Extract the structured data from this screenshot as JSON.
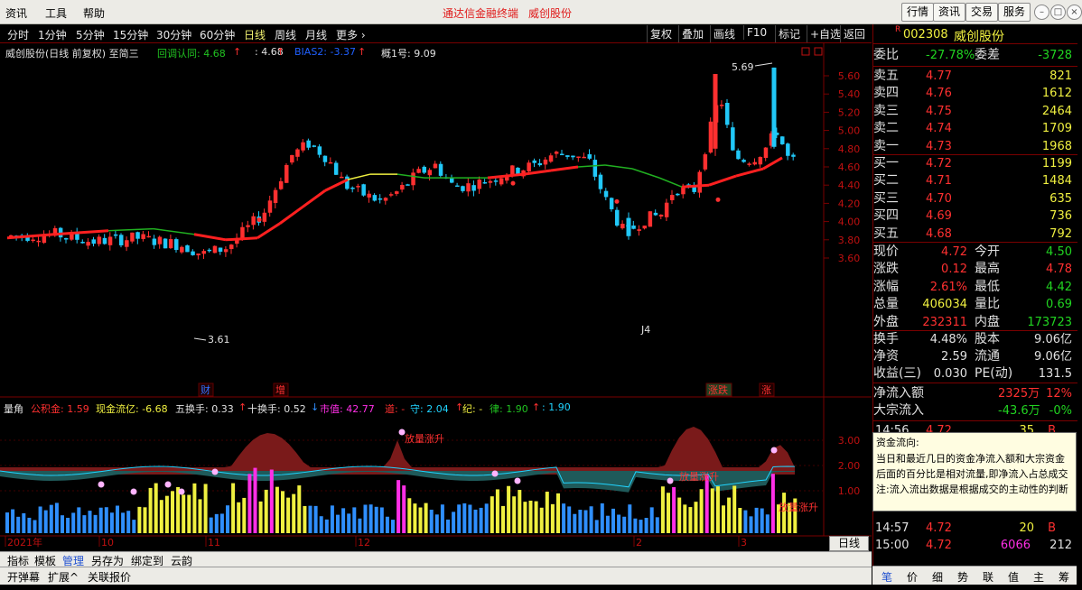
{
  "menubar": {
    "items": [
      "资讯",
      "工具",
      "帮助"
    ],
    "center_title": "通达信金融终端",
    "stock_title": "威创股份",
    "right_buttons": [
      "行情",
      "资讯",
      "交易",
      "服务"
    ]
  },
  "toolbar": {
    "periods": [
      "分时",
      "1分钟",
      "5分钟",
      "15分钟",
      "30分钟",
      "60分钟",
      "日线",
      "周线",
      "月线",
      "更多 ›"
    ],
    "active_period": "日线",
    "tools": [
      "复权",
      "叠加",
      "画线",
      "F10",
      "标记",
      "+自选",
      "返回"
    ]
  },
  "chart_header": {
    "name": "威创股份(日线 前复权) 至简三",
    "items": [
      {
        "label": "回调认同: 4.68",
        "color": "#21c321"
      },
      {
        "label": "↑",
        "color": "#ff3030"
      },
      {
        "label": ": 4.68",
        "color": "#e0e0e0"
      },
      {
        "label": "↑",
        "color": "#ff3030"
      },
      {
        "label": "BIAS2: -3.37",
        "color": "#2060ff"
      },
      {
        "label": "↑",
        "color": "#ff3030"
      },
      {
        "label": "概1号: 9.09",
        "color": "#e0e0e0"
      }
    ],
    "annotations": {
      "high_price": "5.69",
      "low_price": "3.61",
      "marker_j4": "J4"
    },
    "tags": [
      {
        "text": "财",
        "color": "#3070ff"
      },
      {
        "text": "增",
        "color": "#ff3030"
      },
      {
        "text": "涨跌",
        "color": "#ff3030"
      },
      {
        "text": "涨",
        "color": "#ff3030"
      }
    ]
  },
  "sub_header": {
    "items": [
      {
        "label": "量角",
        "color": "#e0e0e0"
      },
      {
        "label": "公积金: 1.59",
        "color": "#ff3030"
      },
      {
        "label": "现金流亿: -6.68",
        "color": "#f0f040"
      },
      {
        "label": "五换手: 0.33",
        "color": "#e0e0e0"
      },
      {
        "label": "↑",
        "color": "#ff3030"
      },
      {
        "label": "十换手: 0.52",
        "color": "#e0e0e0"
      },
      {
        "label": "↓",
        "color": "#2f8fff"
      },
      {
        "label": "市值: 42.77",
        "color": "#ff2fe6"
      },
      {
        "label": "道: -",
        "color": "#ff3030"
      },
      {
        "label": "守: 2.04",
        "color": "#21d4ff"
      },
      {
        "label": "↑",
        "color": "#ff3030"
      },
      {
        "label": "纪: -",
        "color": "#f0f040"
      },
      {
        "label": "律: 1.90",
        "color": "#21c321"
      },
      {
        "label": "↑",
        "color": "#ff3030"
      },
      {
        "label": ": 1.90",
        "color": "#21d4ff"
      }
    ],
    "labels": [
      "放量涨升",
      "放量涨升",
      "放量涨升"
    ]
  },
  "time_axis": [
    "2021年",
    "10",
    "11",
    "12",
    "2",
    "3"
  ],
  "price_axis": [
    "5.60",
    "5.40",
    "5.20",
    "5.00",
    "4.80",
    "4.60",
    "4.40",
    "4.20",
    "4.00",
    "3.80",
    "3.60"
  ],
  "sub_axis": [
    "3.00",
    "2.00",
    "1.00"
  ],
  "quote": {
    "code": "002308",
    "name": "威创股份",
    "weibi_label": "委比",
    "weibi": "-27.78%",
    "weicha_label": "委差",
    "weicha": "-3728",
    "asks": [
      {
        "label": "卖五",
        "price": "4.77",
        "vol": "821"
      },
      {
        "label": "卖四",
        "price": "4.76",
        "vol": "1612"
      },
      {
        "label": "卖三",
        "price": "4.75",
        "vol": "2464"
      },
      {
        "label": "卖二",
        "price": "4.74",
        "vol": "1709"
      },
      {
        "label": "卖一",
        "price": "4.73",
        "vol": "1968"
      }
    ],
    "bids": [
      {
        "label": "买一",
        "price": "4.72",
        "vol": "1199"
      },
      {
        "label": "买二",
        "price": "4.71",
        "vol": "1484"
      },
      {
        "label": "买三",
        "price": "4.70",
        "vol": "635"
      },
      {
        "label": "买四",
        "price": "4.69",
        "vol": "736"
      },
      {
        "label": "买五",
        "price": "4.68",
        "vol": "792"
      }
    ],
    "stats1": [
      {
        "l": "现价",
        "v": "4.72",
        "vc": "#ff3030",
        "l2": "今开",
        "v2": "4.50",
        "v2c": "#21d421"
      },
      {
        "l": "涨跌",
        "v": "0.12",
        "vc": "#ff3030",
        "l2": "最高",
        "v2": "4.78",
        "v2c": "#ff3030"
      },
      {
        "l": "涨幅",
        "v": "2.61%",
        "vc": "#ff3030",
        "l2": "最低",
        "v2": "4.42",
        "v2c": "#21d421"
      },
      {
        "l": "总量",
        "v": "406034",
        "vc": "#f0f040",
        "l2": "量比",
        "v2": "0.69",
        "v2c": "#21d421"
      },
      {
        "l": "外盘",
        "v": "232311",
        "vc": "#ff3030",
        "l2": "内盘",
        "v2": "173723",
        "v2c": "#21d421"
      }
    ],
    "stats2": [
      {
        "l": "换手",
        "v": "4.48%",
        "vc": "#e0e0e0",
        "l2": "股本",
        "v2": "9.06亿",
        "v2c": "#e0e0e0"
      },
      {
        "l": "净资",
        "v": "2.59",
        "vc": "#e0e0e0",
        "l2": "流通",
        "v2": "9.06亿",
        "v2c": "#e0e0e0"
      },
      {
        "l": "收益(三)",
        "v": "0.030",
        "vc": "#e0e0e0",
        "l2": "PE(动)",
        "v2": "131.5",
        "v2c": "#e0e0e0"
      }
    ],
    "net_inflow_label": "净流入额",
    "net_inflow": "2325万",
    "net_inflow_pct": "12%",
    "block_label": "大宗流入",
    "block": "-43.6万",
    "block_pct": "-0%",
    "ticks": [
      {
        "t": "14:56",
        "p": "4.72",
        "v": "35",
        "s": "B"
      },
      {
        "t": "14:57",
        "p": "4.72",
        "v": "20",
        "s": "B"
      },
      {
        "t": "15:00",
        "p": "4.72",
        "v": "6066",
        "n": "212"
      }
    ]
  },
  "tooltip": {
    "title": "资金流向:",
    "lines": [
      "当日和最近几日的资金净流入额和大宗资金",
      "后面的百分比是相对流量,即净流入占总成交",
      "注:流入流出数据是根据成交的主动性的判断"
    ]
  },
  "bottom": {
    "tabs1": [
      "指标",
      "模板",
      "管理",
      "另存为",
      "绑定到",
      "云韵"
    ],
    "tabs2": [
      "开弹幕",
      "扩展^",
      "关联报价"
    ],
    "day_button": "日线",
    "right_tabs": [
      "笔",
      "价",
      "细",
      "势",
      "联",
      "值",
      "主",
      "筹"
    ]
  },
  "colors": {
    "up": "#ff3030",
    "down": "#21c8f8",
    "ma_red": "#ff2020",
    "ma_yellow": "#f0f040",
    "ma_green": "#21b021",
    "grid": "#7a0000"
  }
}
